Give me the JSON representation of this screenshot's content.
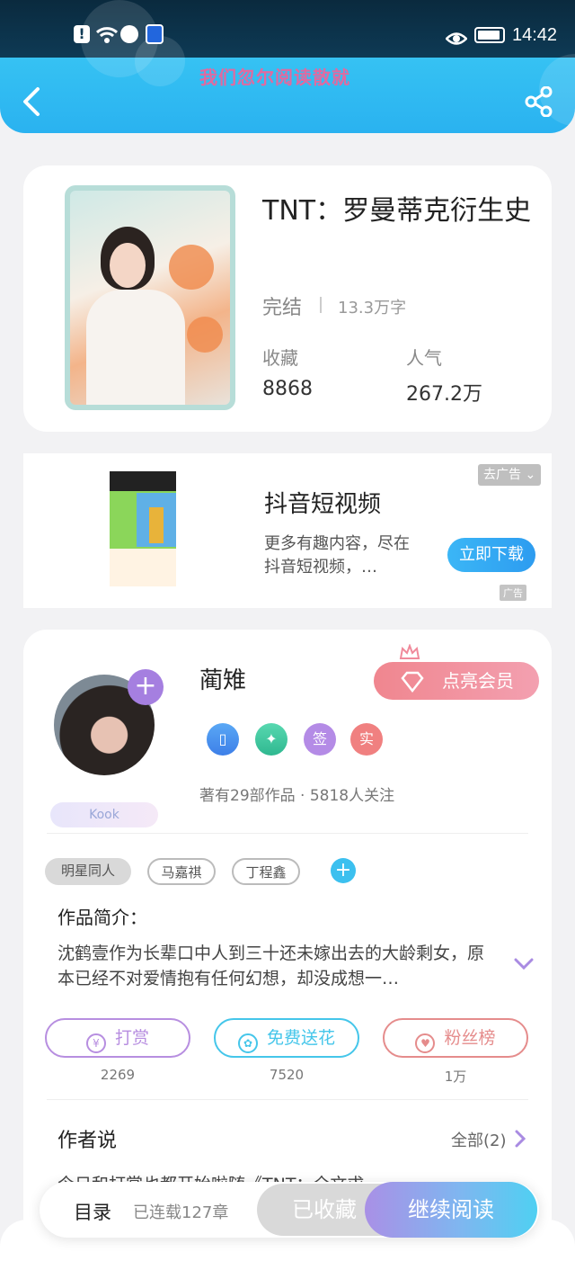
{
  "status_bar": {
    "time": "14:42"
  },
  "header": {
    "marquee_text": "我们忽尔阅读散就"
  },
  "book": {
    "title": "TNT：罗曼蒂克衍生史",
    "status": "完结",
    "word_count": "13.3万字",
    "favorites_label": "收藏",
    "favorites_value": "8868",
    "popularity_label": "人气",
    "popularity_value": "267.2万"
  },
  "ad": {
    "title": "抖音短视频",
    "description": "更多有趣内容，尽在抖音短视频，…",
    "close_label": "去广告",
    "download_label": "立即下载",
    "ad_tag": "广告"
  },
  "author": {
    "name": "蔺雉",
    "fan_badge": "Kook",
    "vip_label": "点亮会员",
    "medals": [
      "签",
      "实"
    ],
    "meta": "著有29部作品 · 5818人关注"
  },
  "tags": {
    "main": "明星同人",
    "items": [
      "马嘉祺",
      "丁程鑫"
    ]
  },
  "intro": {
    "title": "作品简介：",
    "text": "沈鹤壹作为长辈口中人到三十还未嫁出去的大龄剩女，原本已经不对爱情抱有任何幻想，却没成想一…"
  },
  "actions": [
    {
      "label": "打赏",
      "count": "2269",
      "color": "#b78ee0"
    },
    {
      "label": "免费送花",
      "count": "7520",
      "color": "#45c6ea"
    },
    {
      "label": "粉丝榜",
      "count": "1万",
      "color": "#e58c8c"
    }
  ],
  "author_say": {
    "title": "作者说",
    "all_label": "全部(2)",
    "peek": "今日和打赏也都开始啦随《TNT：全文求"
  },
  "bottom_bar": {
    "toc_label": "目录",
    "chapter_count": "已连载127章",
    "collected_label": "已收藏",
    "read_label": "继续阅读"
  }
}
